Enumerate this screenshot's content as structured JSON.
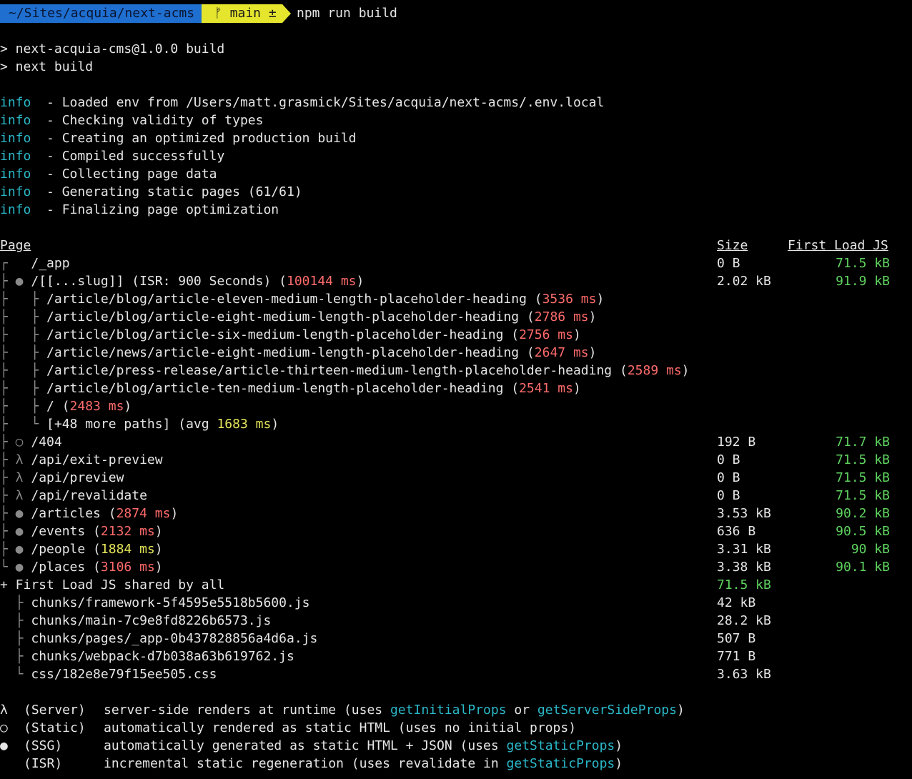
{
  "prompt": {
    "path": "~/Sites/acquia/next-acms",
    "branch_icon": "git-branch-icon",
    "branch_glyph": "ᚠ",
    "branch": "main ±",
    "command": "npm run build",
    "colors": {
      "path_bg": "#1f6fd1",
      "branch_bg": "#e5e52e"
    }
  },
  "script_lines": [
    "> next-acquia-cms@1.0.0 build",
    "> next build"
  ],
  "info_prefix": "info",
  "info_lines": [
    "  - Loaded env from /Users/matt.grasmick/Sites/acquia/next-acms/.env.local",
    "  - Checking validity of types",
    "  - Creating an optimized production build",
    "  - Compiled successfully",
    "  - Collecting page data",
    "  - Generating static pages (61/61)",
    "  - Finalizing page optimization"
  ],
  "table": {
    "headers": {
      "page": "Page",
      "size": "Size",
      "first_load": "First Load JS"
    },
    "rows": [
      {
        "tree": "┌  ",
        "page": " /_app",
        "ms": "",
        "size": "0 B",
        "first_load": "71.5 kB"
      },
      {
        "tree": "├ ● ",
        "page": "/[[...slug]] (ISR: 900 Seconds) (",
        "ms": "100144 ms",
        "after": ")",
        "ms_color": "red",
        "size": "2.02 kB",
        "first_load": "91.9 kB"
      },
      {
        "tree": "├   ├ ",
        "page": "/article/blog/article-eleven-medium-length-placeholder-heading (",
        "ms": "3536 ms",
        "after": ")",
        "ms_color": "red",
        "size": "",
        "first_load": ""
      },
      {
        "tree": "├   ├ ",
        "page": "/article/blog/article-eight-medium-length-placeholder-heading (",
        "ms": "2786 ms",
        "after": ")",
        "ms_color": "red",
        "size": "",
        "first_load": ""
      },
      {
        "tree": "├   ├ ",
        "page": "/article/blog/article-six-medium-length-placeholder-heading (",
        "ms": "2756 ms",
        "after": ")",
        "ms_color": "red",
        "size": "",
        "first_load": ""
      },
      {
        "tree": "├   ├ ",
        "page": "/article/news/article-eight-medium-length-placeholder-heading (",
        "ms": "2647 ms",
        "after": ")",
        "ms_color": "red",
        "size": "",
        "first_load": ""
      },
      {
        "tree": "├   ├ ",
        "page": "/article/press-release/article-thirteen-medium-length-placeholder-heading (",
        "ms": "2589 ms",
        "after": ")",
        "ms_color": "red",
        "size": "",
        "first_load": ""
      },
      {
        "tree": "├   ├ ",
        "page": "/article/blog/article-ten-medium-length-placeholder-heading (",
        "ms": "2541 ms",
        "after": ")",
        "ms_color": "red",
        "size": "",
        "first_load": ""
      },
      {
        "tree": "├   ├ ",
        "page": "/ (",
        "ms": "2483 ms",
        "after": ")",
        "ms_color": "red",
        "size": "",
        "first_load": ""
      },
      {
        "tree": "├   └ ",
        "page": "[+48 more paths] (avg ",
        "ms": "1683 ms",
        "after": ")",
        "ms_color": "yellow",
        "size": "",
        "first_load": ""
      },
      {
        "tree": "├ ○ ",
        "page": "/404",
        "ms": "",
        "size": "192 B",
        "first_load": "71.7 kB"
      },
      {
        "tree": "├ λ ",
        "page": "/api/exit-preview",
        "ms": "",
        "size": "0 B",
        "first_load": "71.5 kB"
      },
      {
        "tree": "├ λ ",
        "page": "/api/preview",
        "ms": "",
        "size": "0 B",
        "first_load": "71.5 kB"
      },
      {
        "tree": "├ λ ",
        "page": "/api/revalidate",
        "ms": "",
        "size": "0 B",
        "first_load": "71.5 kB"
      },
      {
        "tree": "├ ● ",
        "page": "/articles (",
        "ms": "2874 ms",
        "after": ")",
        "ms_color": "red",
        "size": "3.53 kB",
        "first_load": "90.2 kB"
      },
      {
        "tree": "├ ● ",
        "page": "/events (",
        "ms": "2132 ms",
        "after": ")",
        "ms_color": "red",
        "size": "636 B",
        "first_load": "90.5 kB"
      },
      {
        "tree": "├ ● ",
        "page": "/people (",
        "ms": "1884 ms",
        "after": ")",
        "ms_color": "yellow",
        "size": "3.31 kB",
        "first_load": "90 kB"
      },
      {
        "tree": "└ ● ",
        "page": "/places (",
        "ms": "3106 ms",
        "after": ")",
        "ms_color": "red",
        "size": "3.38 kB",
        "first_load": "90.1 kB"
      }
    ],
    "shared": {
      "label": "+ First Load JS shared by all",
      "size": "71.5 kB"
    },
    "chunks": [
      {
        "tree": "  ├ ",
        "name": "chunks/framework-5f4595e5518b5600.js",
        "size": "42 kB"
      },
      {
        "tree": "  ├ ",
        "name": "chunks/main-7c9e8fd8226b6573.js",
        "size": "28.2 kB"
      },
      {
        "tree": "  ├ ",
        "name": "chunks/pages/_app-0b437828856a4d6a.js",
        "size": "507 B"
      },
      {
        "tree": "  ├ ",
        "name": "chunks/webpack-d7b038a63b619762.js",
        "size": "771 B"
      },
      {
        "tree": "  └ ",
        "name": "css/182e8e79f15ee505.css",
        "size": "3.63 kB"
      }
    ]
  },
  "legend": [
    {
      "symbol": "λ",
      "kind": "(Server)",
      "text": "server-side renders at runtime (uses ",
      "fn": "getInitialProps",
      "mid": " or ",
      "fn2": "getServerSideProps",
      "end": ")"
    },
    {
      "symbol": "○",
      "kind": "(Static)",
      "text": "automatically rendered as static HTML (uses no initial props)",
      "fn": "",
      "mid": "",
      "fn2": "",
      "end": ""
    },
    {
      "symbol": "●",
      "kind": "(SSG)",
      "text": "automatically generated as static HTML + JSON (uses ",
      "fn": "getStaticProps",
      "mid": "",
      "fn2": "",
      "end": ")"
    },
    {
      "symbol": "",
      "kind": "(ISR)",
      "text": "incremental static regeneration (uses revalidate in ",
      "fn": "getStaticProps",
      "mid": "",
      "fn2": "",
      "end": ")"
    }
  ]
}
